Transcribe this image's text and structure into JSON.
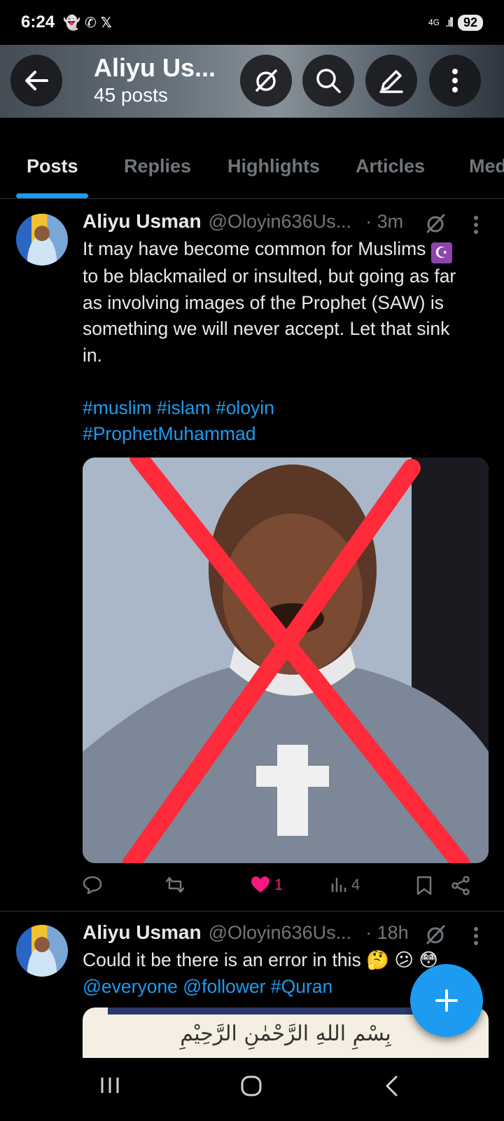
{
  "status_bar": {
    "time": "6:24",
    "network": "4G",
    "battery": "92"
  },
  "header": {
    "name": "Aliyu Us...",
    "post_count": "45 posts"
  },
  "tabs": [
    {
      "label": "Posts",
      "active": true
    },
    {
      "label": "Replies"
    },
    {
      "label": "Highlights"
    },
    {
      "label": "Articles"
    },
    {
      "label": "Med"
    }
  ],
  "posts": [
    {
      "author": "Aliyu Usman",
      "handle": "@Oloyin636Us...",
      "age": "· 3m",
      "text_lines": [
        "It may have become common for Muslims",
        "to be blackmailed or insulted, but going as far",
        "as involving images of the Prophet (SAW) is",
        "something we will never accept. Let that sink",
        "in."
      ],
      "emoji": "☪",
      "hashtags_line1": "#muslim #islam #oloyin",
      "hashtags_line2": "#ProphetMuhammad",
      "likes": "1",
      "views": "4"
    },
    {
      "author": "Aliyu Usman",
      "handle": "@Oloyin636Us...",
      "age": "· 18h",
      "text": "Could it be there is an error in this",
      "emojis": "🤔 😕 😳",
      "mentions": "@everyone @follower #Quran",
      "media_text": "بِسْمِ اللهِ الرَّحْمٰنِ الرَّحِيْمِ"
    }
  ],
  "colors": {
    "accent": "#1d9bf0",
    "like": "#f91880",
    "muted": "#71767b",
    "divider": "#2f3336"
  }
}
